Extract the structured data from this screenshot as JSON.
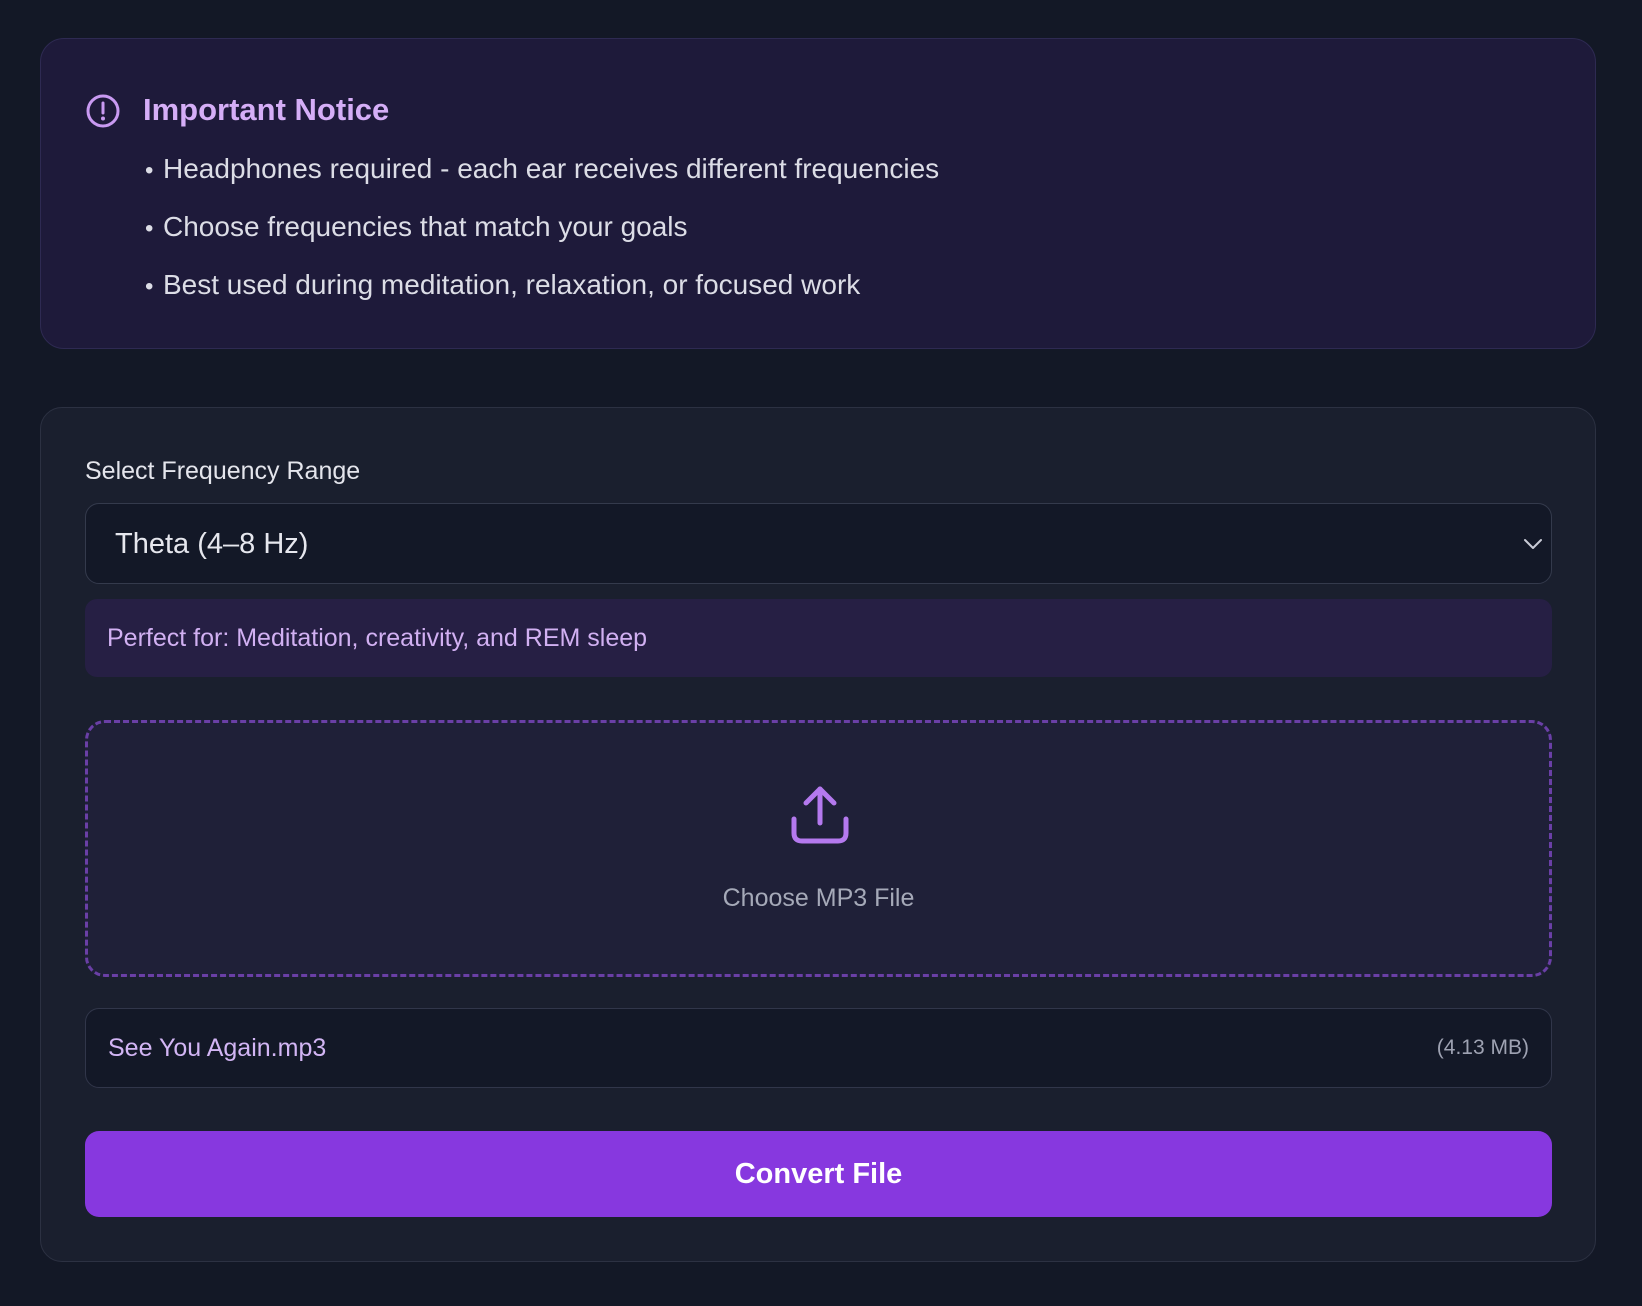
{
  "notice": {
    "icon": "exclamation-circle-icon",
    "title": "Important Notice",
    "items": [
      "Headphones required - each ear receives different frequencies",
      "Choose frequencies that match your goals",
      "Best used during meditation, relaxation, or focused work"
    ]
  },
  "frequency": {
    "label": "Select Frequency Range",
    "selected": "Theta (4–8 Hz)",
    "description": "Perfect for: Meditation, creativity, and REM sleep"
  },
  "upload": {
    "icon": "upload-icon",
    "label": "Choose MP3 File"
  },
  "file": {
    "name": "See You Again.mp3",
    "size": "(4.13 MB)"
  },
  "actions": {
    "convert_label": "Convert File"
  },
  "colors": {
    "background": "#131826",
    "accent": "#8738df",
    "notice_title": "#d5aef7",
    "dashed_border": "#6a3fa6"
  }
}
